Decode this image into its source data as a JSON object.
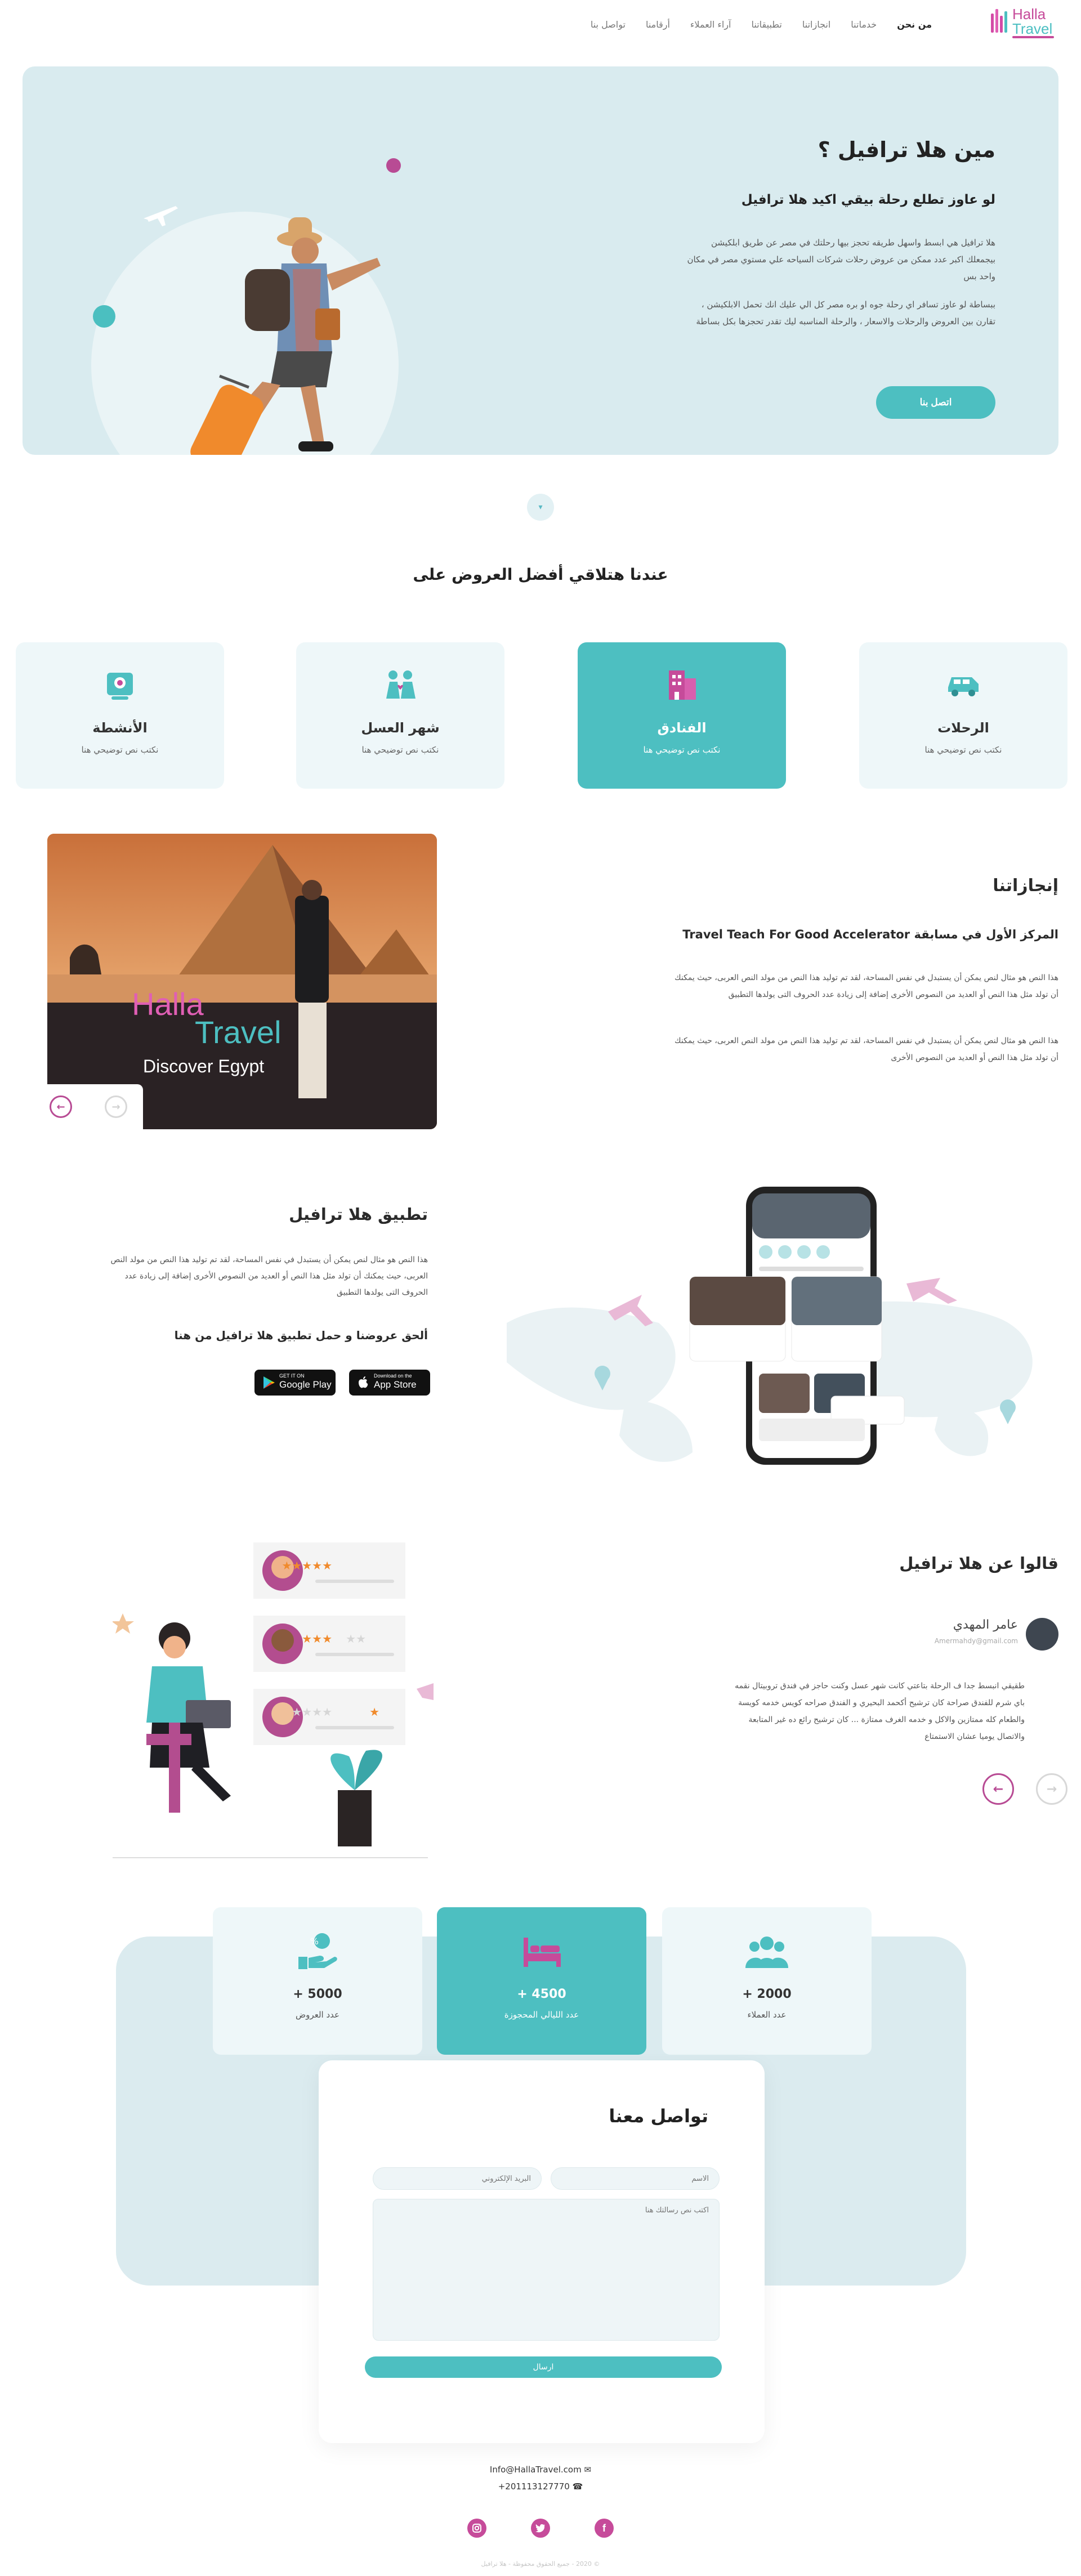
{
  "brand": {
    "logo_line1": "Halla",
    "logo_line2": "Travel",
    "pink": "#c64b9a",
    "teal": "#4dbfc1"
  },
  "nav": {
    "items": [
      {
        "label": "من نحن",
        "active": true
      },
      {
        "label": "خدماتنا"
      },
      {
        "label": "انجازاتنا"
      },
      {
        "label": "تطبيقاتنا"
      },
      {
        "label": "آراء العملاء"
      },
      {
        "label": "أرقامنا"
      },
      {
        "label": "تواصل بنا"
      }
    ]
  },
  "hero": {
    "title": "مين هلا ترافيل ؟",
    "subtitle": "لو عاوز تطلع رحلة بيقي اكيد هلا ترافيل",
    "para1": "هلا ترافيل هي ابسط واسهل طريقه تحجز بيها رحلتك في مصر عن طريق ابلكيشن بيجمعلك اكبر عدد ممكن من عروض رحلات شركات السياحه علي مستوي مصر في مكان واحد بس",
    "para2": "ببساطة لو عاوز تسافر اي رحلة جوه او بره مصر كل الي عليك انك تحمل الابلكيشن ، تقارن بين العروض والرحلات والاسعار ، والرحلة المناسبه ليك تقدر تحجزها بكل بساطة",
    "cta": "اتصل بنا"
  },
  "offers": {
    "title": "عندنا هتلاقي أفضل العروض على",
    "items": [
      {
        "title": "الرحلات",
        "subtitle": "نكتب نص توضيحي هنا",
        "icon": "van-icon"
      },
      {
        "title": "الفنادق",
        "subtitle": "نكتب نص توضيحي هنا",
        "icon": "hotel-icon",
        "active": true
      },
      {
        "title": "شهر العسل",
        "subtitle": "نكتب نص توضيحي هنا",
        "icon": "couple-icon"
      },
      {
        "title": "الأنشطة",
        "subtitle": "نكتب نص توضيحي هنا",
        "icon": "activity-icon"
      }
    ]
  },
  "achievements": {
    "title": "إنجازاتنا",
    "subtitle": "المركز الأول في مسابقة Travel Teach For Good Accelerator",
    "para1": "هذا النص هو مثال لنص يمكن أن يستبدل في نفس المساحة، لقد تم توليد هذا النص من مولد النص العربى، حيث يمكنك أن تولد مثل هذا النص أو العديد من النصوص الأخرى إضافة إلى زيادة عدد الحروف التى يولدها التطبيق",
    "para2": "هذا النص هو مثال لنص يمكن أن يستبدل في نفس المساحة، لقد تم توليد هذا النص من مولد النص العربى، حيث يمكنك أن تولد مثل هذا النص أو العديد من النصوص الأخرى",
    "slide_caption": "Discover Egypt",
    "slide_logo1": "Halla",
    "slide_logo2": "Travel"
  },
  "app": {
    "title": "تطبيق هلا ترافيل",
    "para": "هذا النص هو مثال لنص يمكن أن يستبدل في نفس المساحة، لقد تم توليد هذا النص من مولد النص العربى، حيث يمكنك أن تولد مثل هذا النص أو العديد من النصوص الأخرى إضافة إلى زيادة عدد الحروف التى يولدها التطبيق",
    "cta_text": "ألحق عروضنا و حمل تطبيق هلا ترافيل من هنا",
    "google_small": "GET IT ON",
    "google_big": "Google Play",
    "apple_small": "Download on the",
    "apple_big": "App Store"
  },
  "testimonials": {
    "title": "قالوا عن هلا ترافيل",
    "name": "عامر المهدي",
    "email": "Amermahdy@gmail.com",
    "quote": "طقيقي انبسط جدا ف الرحلة بتاعتي كانت شهر عسل وكنت حاجز في فندق تروبيتال نقمه باي شرم للفندق صراحة كان ترشيح أكحمد البحيري و الفندق صراحه كويس خدمه كويسة والطعام كله ممتازين والاكل و خدمه الغرف ممتازة ... كان ترشيح رائع ده غير المتابعة والاتصال يوميا عشان الاستمتاع"
  },
  "stats": {
    "items": [
      {
        "value": "+ 2000",
        "label": "عدد العملاء",
        "icon": "users-icon"
      },
      {
        "value": "+ 4500",
        "label": "عدد الليالي المحجوزة",
        "icon": "bed-icon",
        "active": true
      },
      {
        "value": "+ 5000",
        "label": "عدد العروض",
        "icon": "offer-hand-icon"
      }
    ]
  },
  "contact": {
    "title": "تواصل معنا",
    "name_placeholder": "الاسم",
    "email_placeholder": "البريد الإلكتروني",
    "message_placeholder": "اكتب نص رسالتك هنا",
    "send": "ارسال"
  },
  "footer": {
    "email": "Info@HallaTravel.com",
    "phone": "+201113127770",
    "copyright": "© 2020 - جميع الحقوق محفوظة - هلا ترافيل"
  }
}
